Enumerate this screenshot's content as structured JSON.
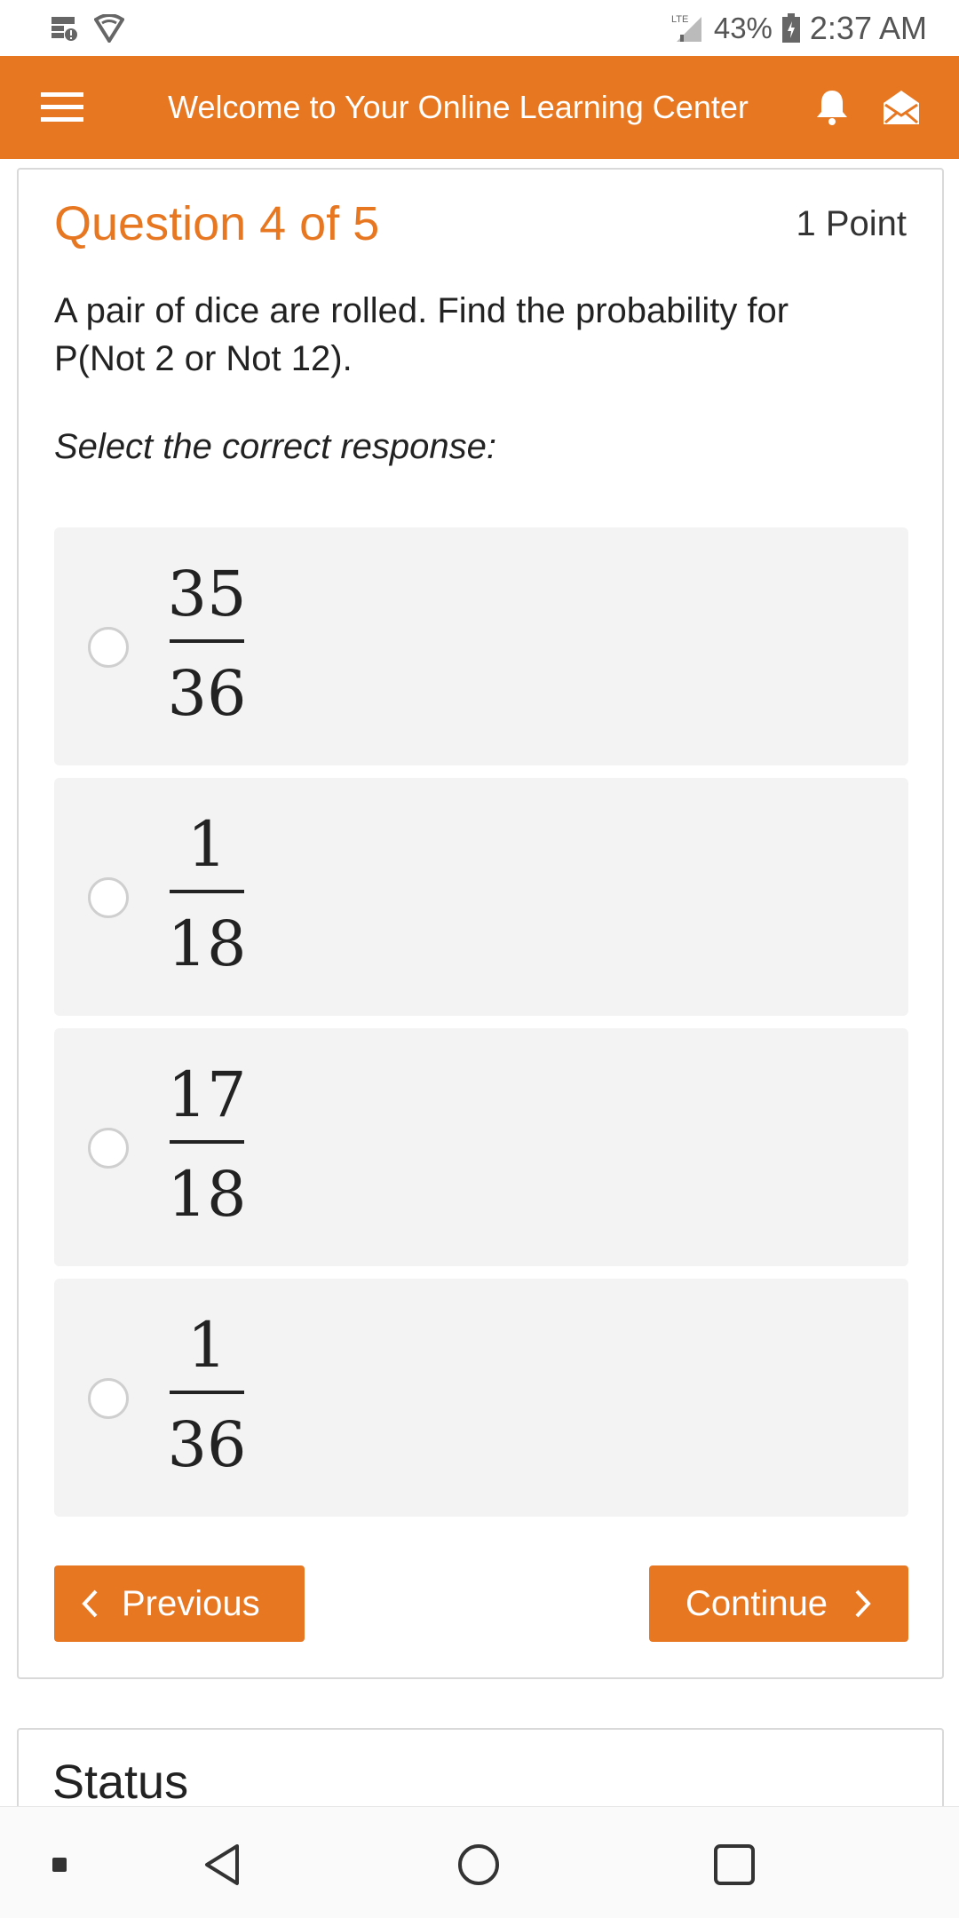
{
  "status_bar": {
    "network": "LTE",
    "battery": "43%",
    "time": "2:37 AM"
  },
  "header": {
    "title": "Welcome to Your Online Learning Center",
    "menu_icon": "hamburger-icon",
    "notification_icon": "bell-icon",
    "messages_icon": "envelope-icon"
  },
  "question": {
    "title": "Question 4 of 5",
    "points": "1 Point",
    "text": "A pair of dice are rolled. Find the probability for P(Not 2 or Not 12).",
    "instruction": "Select the correct response:",
    "options": [
      {
        "numerator": "35",
        "denominator": "36"
      },
      {
        "numerator": "1",
        "denominator": "18"
      },
      {
        "numerator": "17",
        "denominator": "18"
      },
      {
        "numerator": "1",
        "denominator": "36"
      }
    ]
  },
  "navigation": {
    "previous_label": "Previous",
    "continue_label": "Continue"
  },
  "status_section": {
    "title": "Status"
  },
  "colors": {
    "accent": "#e87722",
    "option_bg": "#f3f3f3"
  }
}
